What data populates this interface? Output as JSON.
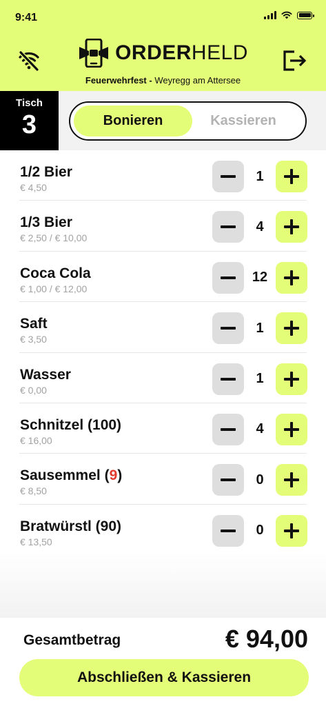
{
  "status": {
    "time": "9:41"
  },
  "header": {
    "brand_bold": "ORDER",
    "brand_light": "HELD",
    "event_name": "Feuerwehrfest",
    "event_separator": " - ",
    "event_location": "Weyregg am Attersee"
  },
  "table": {
    "label": "Tisch",
    "number": "3"
  },
  "segment": {
    "active": "Bonieren",
    "inactive": "Kassieren"
  },
  "items": [
    {
      "name": "1/2 Bier",
      "price": "€ 4,50",
      "qty": "1"
    },
    {
      "name": "1/3 Bier",
      "price": "€ 2,50 / € 10,00",
      "qty": "4"
    },
    {
      "name": "Coca Cola",
      "price": "€ 1,00 / € 12,00",
      "qty": "12"
    },
    {
      "name": "Saft",
      "price": "€ 3,50",
      "qty": "1"
    },
    {
      "name": "Wasser",
      "price": "€ 0,00",
      "qty": "1"
    },
    {
      "name": "Schnitzel (100)",
      "price": "€ 16,00",
      "qty": "4"
    },
    {
      "name_prefix": "Sausemmel (",
      "name_highlight": "9",
      "name_suffix": ")",
      "price": "€ 8,50",
      "qty": "0"
    },
    {
      "name": "Bratwürstl (90)",
      "price": "€ 13,50",
      "qty": "0"
    }
  ],
  "footer": {
    "total_label": "Gesamtbetrag",
    "total_value": "€ 94,00",
    "cta_label": "Abschließen & Kassieren"
  },
  "colors": {
    "accent": "#e4fd78",
    "highlight": "#e13b2e",
    "muted": "#a2a2a2"
  },
  "icons": [
    "wifi-off-icon",
    "bowtie-logo-icon",
    "logout-icon",
    "minus-icon",
    "plus-icon",
    "signal-icon",
    "wifi-icon",
    "battery-icon"
  ]
}
